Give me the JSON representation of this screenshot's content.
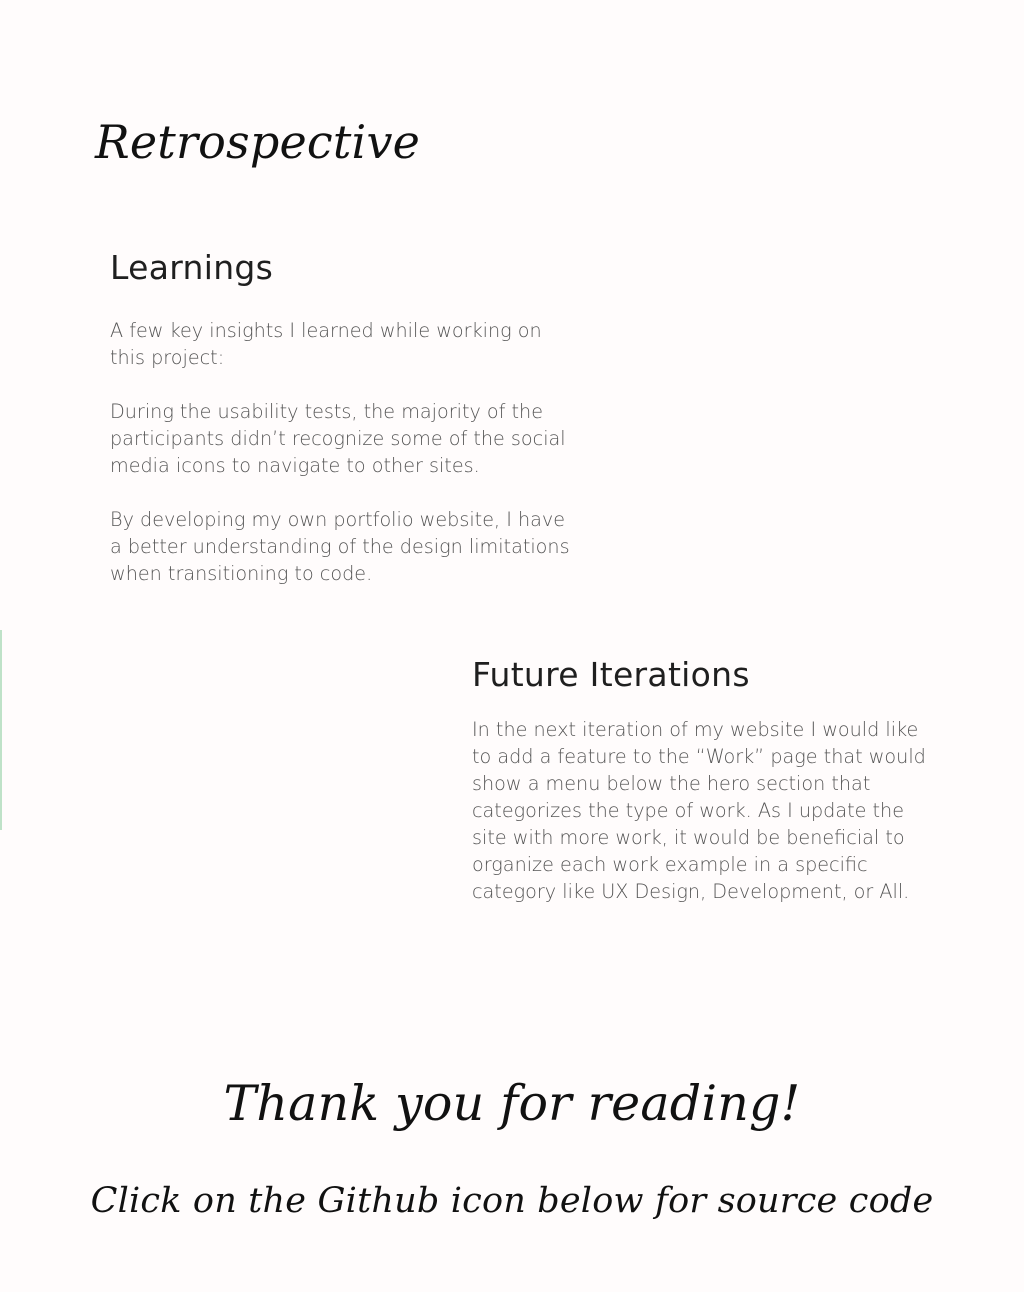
{
  "retrospective": {
    "title": "Retrospective"
  },
  "learnings": {
    "heading": "Learnings",
    "paragraphs": [
      "A few key insights I learned while working on this project:",
      "During the usability tests, the majority of the participants didn’t recognize some of the social media icons to navigate to other sites.",
      "By developing my own portfolio website, I have a better understanding of  the design limitations when transitioning to code."
    ]
  },
  "future_iterations": {
    "heading": "Future Iterations",
    "paragraph": "In the next iteration of my website I would like to add a feature to the “Work” page that would show a menu below the hero section that categorizes the type of work. As I update the site with more work, it would be beneficial to organize each work example in a specific category like UX Design, Development, or All."
  },
  "closing": {
    "thank_you": "Thank you for reading!",
    "cta": "Click on the Github icon below for source code"
  },
  "colors": {
    "background": "#fffcfc",
    "accent_line": "#bfe2c8",
    "heading_text": "#1f1f1f",
    "body_text": "#555555"
  }
}
